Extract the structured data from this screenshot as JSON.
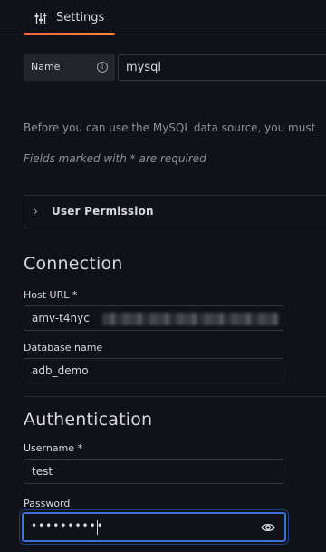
{
  "tabs": {
    "settings_label": "Settings",
    "settings_icon": "sliders-icon"
  },
  "name_field": {
    "label": "Name",
    "info_glyph": "i",
    "value": "mysql"
  },
  "description": "Before you can use the MySQL data source, you must",
  "required_note": "Fields marked with * are required",
  "permission": {
    "label": "User Permission"
  },
  "connection": {
    "title": "Connection",
    "host_label": "Host URL *",
    "host_value_visible": "amv-t4nyc",
    "db_label": "Database name",
    "db_value": "adb_demo"
  },
  "authentication": {
    "title": "Authentication",
    "username_label": "Username *",
    "username_value": "test",
    "password_label": "Password",
    "password_masked": "••••••••••"
  },
  "colors": {
    "accent_orange": "#f55f3e",
    "focus_blue": "#3d71d9"
  }
}
